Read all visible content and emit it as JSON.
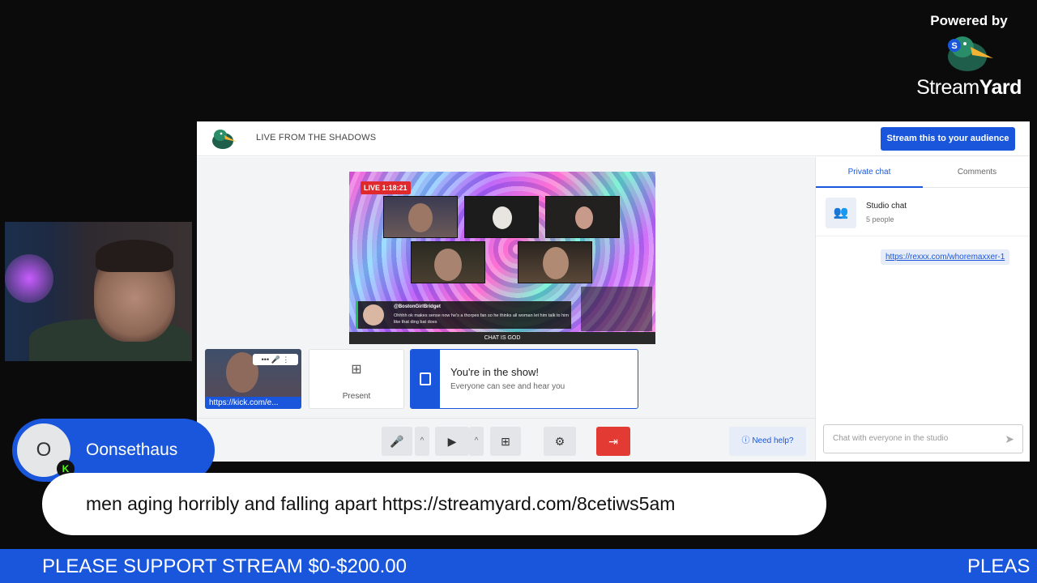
{
  "powered": {
    "label": "Powered by",
    "brand_light": "Stream",
    "brand_bold": "Yard"
  },
  "studio": {
    "title": "LIVE FROM THE SHADOWS",
    "stream_button": "Stream this to your audience",
    "preview": {
      "live_badge": "LIVE 1:18:21",
      "chat_name": "@BostonGirlBridget",
      "chat_msg": "Ohhhh ok makes sense now he's a thorpes fan so he thinks all woman let him talk to him like that ding bat does",
      "footer": "CHAT IS GOD"
    },
    "self_url": "https://kick.com/e...",
    "present_label": "Present",
    "inshow_title": "You're in the show!",
    "inshow_sub": "Everyone can see and hear you",
    "need_help": "Need help?",
    "chat": {
      "tabs": [
        "Private chat",
        "Comments"
      ],
      "active_tab": 0,
      "studio_chat_title": "Studio chat",
      "studio_chat_count": "5 people",
      "link_message": "https://rexxx.com/whoremaxxer-1",
      "input_placeholder": "Chat with everyone in the studio"
    }
  },
  "overlay": {
    "avatar_letter": "O",
    "username": "Oonsethaus",
    "message": "men aging horribly and falling apart https://streamyard.com/8cetiws5am"
  },
  "ticker": {
    "text": "PLEASE SUPPORT STREAM $0-$200.00",
    "text_repeat": "PLEAS"
  },
  "colors": {
    "accent": "#1a56db",
    "leave": "#e33b33",
    "kick": "#53fc18"
  }
}
